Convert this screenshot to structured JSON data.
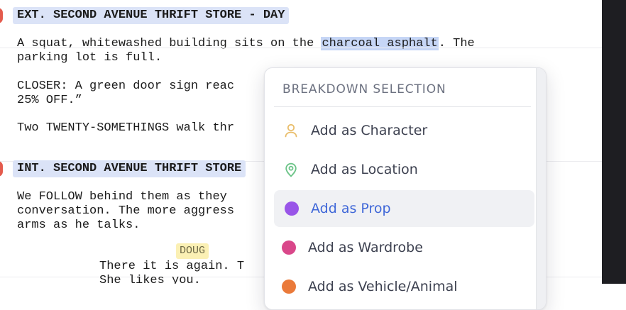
{
  "scenes": [
    {
      "slugline": "EXT. SECOND AVENUE THRIFT STORE - DAY",
      "action_lines": [
        [
          "A squat, whitewashed building sits on the ",
          "charcoal asphalt",
          ". The"
        ],
        [
          "parking lot is full."
        ],
        [
          ""
        ],
        [
          "CLOSER: A green door sign reac"
        ],
        [
          "25% OFF.”"
        ],
        [
          ""
        ],
        [
          "Two TWENTY-SOMETHINGS walk thr"
        ]
      ]
    },
    {
      "slugline": "INT. SECOND AVENUE THRIFT STORE",
      "action_lines": [
        "We FOLLOW behind them as they",
        "conversation. The more aggress",
        "arms as he talks."
      ],
      "character": "DOUG",
      "dialogue": [
        "There it is again. T",
        "She likes you."
      ]
    }
  ],
  "breakdown_menu": {
    "title": "BREAKDOWN SELECTION",
    "items": [
      {
        "label": "Add as Character",
        "icon": "person-icon",
        "color": "#e9bd6a"
      },
      {
        "label": "Add as Location",
        "icon": "map-pin-icon",
        "color": "#6cc488"
      },
      {
        "label": "Add as Prop",
        "icon": "dot-icon",
        "color": "#9955e8",
        "active": true
      },
      {
        "label": "Add as Wardrobe",
        "icon": "dot-icon",
        "color": "#d9478a"
      },
      {
        "label": "Add as Vehicle/Animal",
        "icon": "dot-icon",
        "color": "#ea7a3a"
      }
    ]
  },
  "colors": {
    "accent": "#3f67d8",
    "scene_marker": "#e45b4d",
    "slug_highlight": "#dbe3f7",
    "selection_highlight": "#c6d6f6",
    "character_highlight": "#fbf0b4"
  }
}
